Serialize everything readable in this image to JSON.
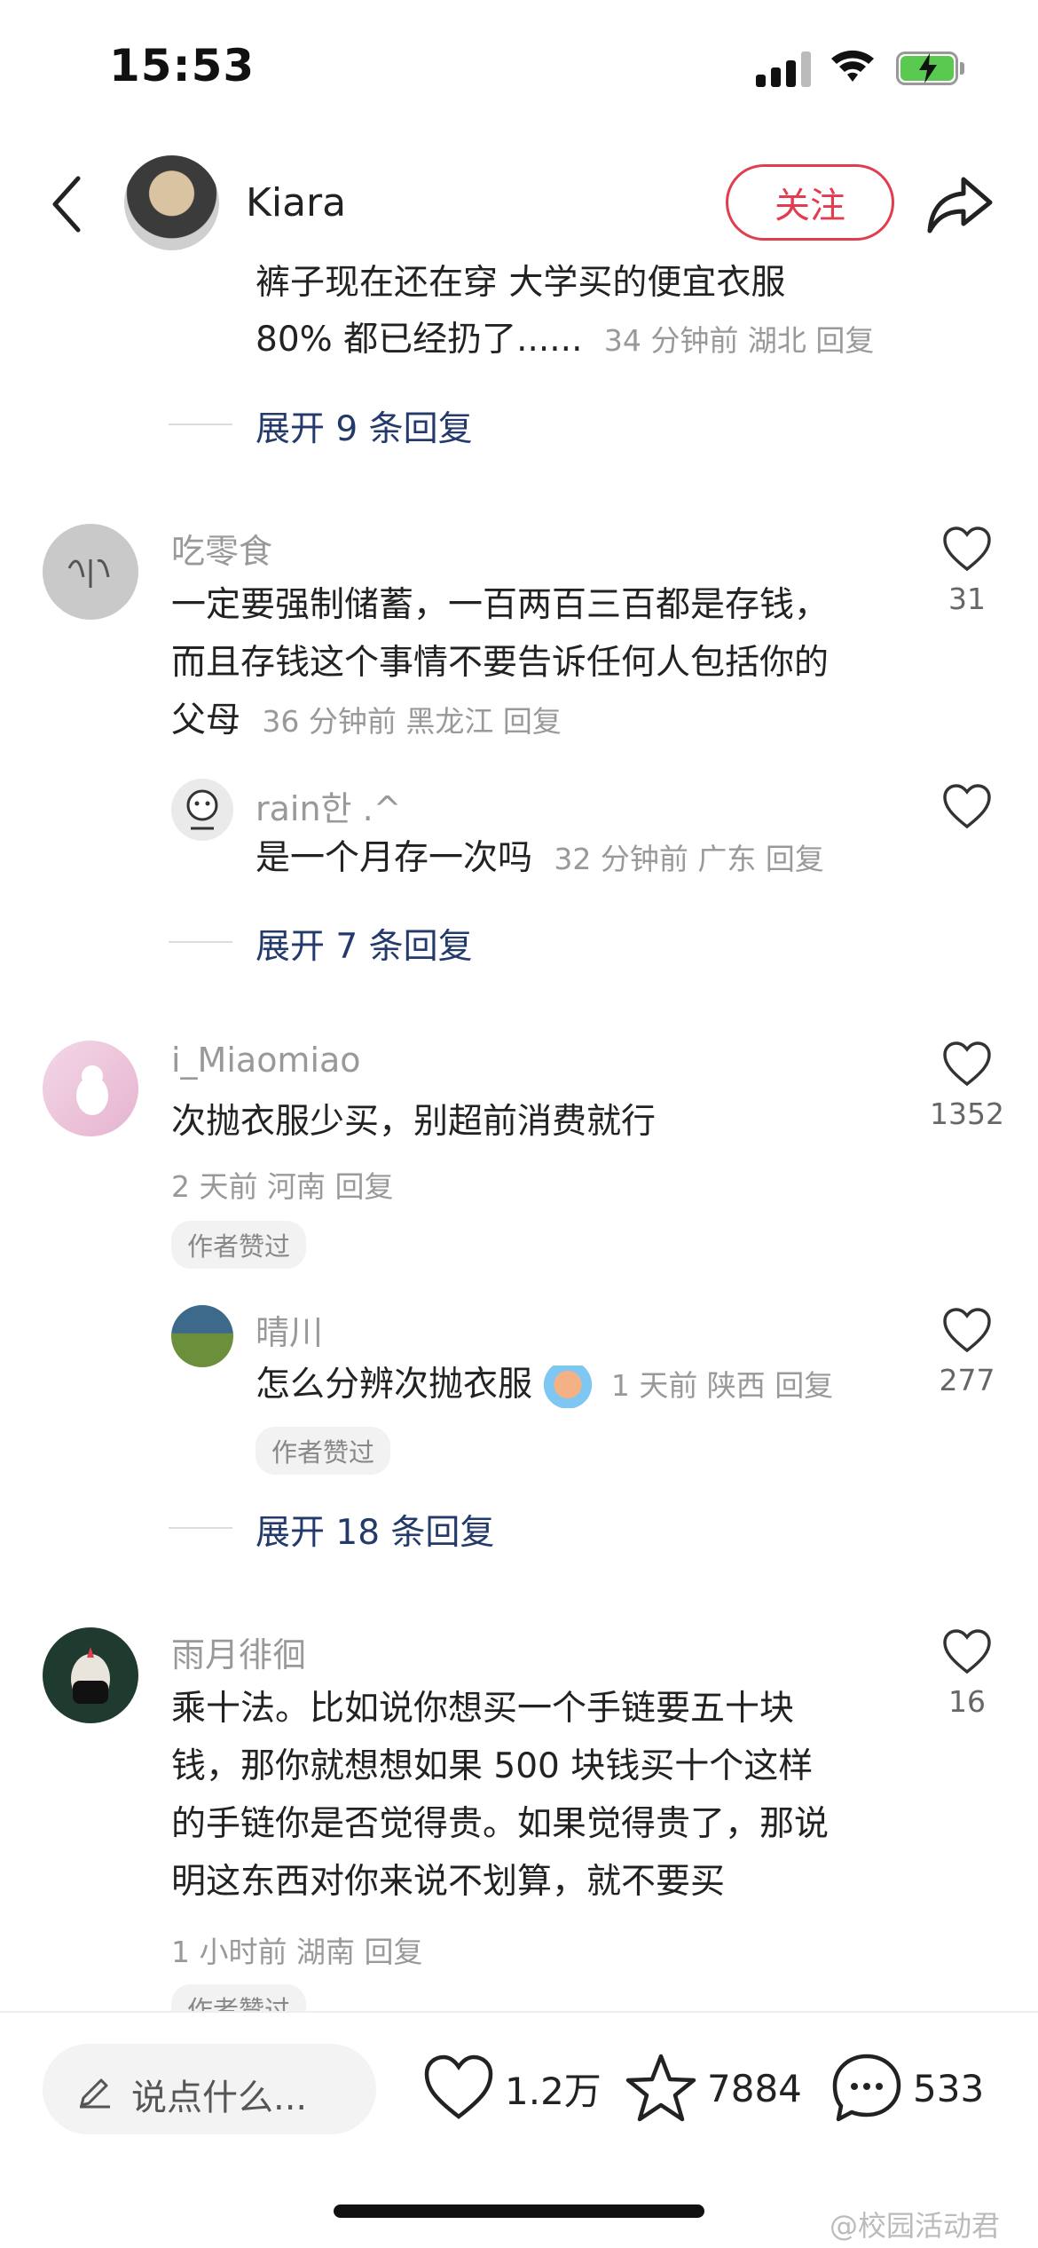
{
  "status_bar": {
    "time": "15:53",
    "battery_level": 0.85
  },
  "header": {
    "author_name": "Kiara",
    "follow_label": "关注"
  },
  "thread0": {
    "text_line1": "裤子现在还在穿 大学买的便宜衣服",
    "text_line2": "80% 都已经扔了......",
    "meta": "34 分钟前 湖北 回复",
    "expand": "展开 9 条回复"
  },
  "comments": [
    {
      "username": "吃零食",
      "lines": [
        "一定要强制储蓄，一百两百三百都是存钱，",
        "而且存钱这个事情不要告诉任何人包括你的",
        "父母"
      ],
      "meta": "36 分钟前 黑龙江 回复",
      "likes": "31",
      "reply": {
        "username": "rain한 .^",
        "text": "是一个月存一次吗",
        "meta": "32 分钟前 广东 回复"
      },
      "expand": "展开 7 条回复"
    },
    {
      "username": "i_Miaomiao",
      "lines": [
        "次抛衣服少买，别超前消费就行"
      ],
      "meta": "2 天前 河南 回复",
      "likes": "1352",
      "badge": "作者赞过",
      "reply": {
        "username": "晴川",
        "text": "怎么分辨次抛衣服",
        "meta": "1 天前 陕西 回复",
        "likes": "277",
        "badge": "作者赞过"
      },
      "expand": "展开 18 条回复"
    },
    {
      "username": "雨月徘徊",
      "lines": [
        "乘十法。比如说你想买一个手链要五十块",
        "钱，那你就想想如果 500 块钱买十个这样",
        "的手链你是否觉得贵。如果觉得贵了，那说",
        "明这东西对你来说不划算，就不要买"
      ],
      "meta": "1 小时前 湖南 回复",
      "likes": "16",
      "badge": "作者赞过"
    }
  ],
  "bottom_bar": {
    "input_placeholder": "说点什么...",
    "likes": "1.2万",
    "favorites": "7884",
    "comments": "533"
  },
  "watermark": "@校园活动君"
}
